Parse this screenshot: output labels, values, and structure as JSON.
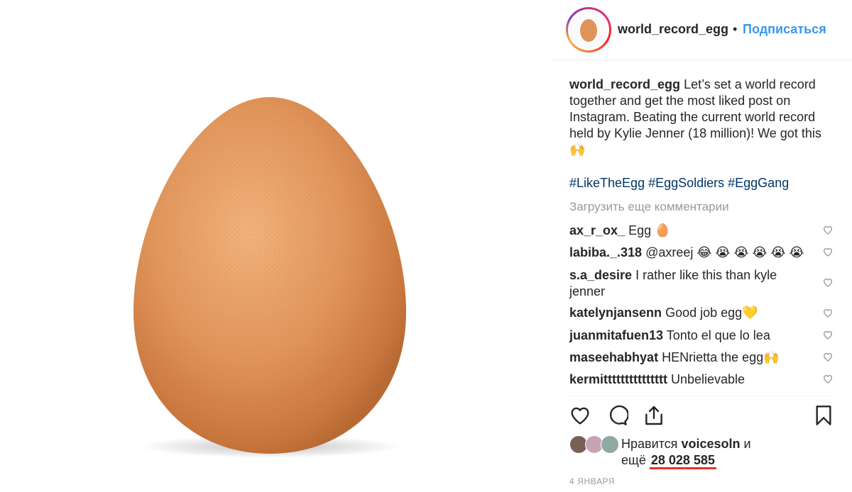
{
  "post": {
    "username": "world_record_egg",
    "separator": "•",
    "follow_label": "Подписаться",
    "caption_text": "Let’s set a world record together and get the most liked post on Instagram. Beating the current world record held by Kylie Jenner (18 million)! We got this 🙌",
    "hashtags": "#LikeTheEgg #EggSoldiers #EggGang",
    "load_more": "Загрузить еще комментарии"
  },
  "comments": [
    {
      "user": "ax_r_ox_",
      "text": "Egg 🥚"
    },
    {
      "user": "labiba._.318",
      "text": "@axreej 😂 😭 😭 😭 😭 😭"
    },
    {
      "user": "s.a_desire",
      "text": "I rather like this than kyle jenner"
    },
    {
      "user": "katelynjansenn",
      "text": "Good job egg💛"
    },
    {
      "user": "juanmitafuen13",
      "text": "Tonto el que lo lea"
    },
    {
      "user": "maseehabhyat",
      "text": "HENrietta the egg🙌"
    },
    {
      "user": "kermittttttttttttttt",
      "text": "Unbelievable"
    }
  ],
  "likes": {
    "prefix": "Нравится",
    "user": "voicesoln",
    "joiner": "и",
    "more": "ещё",
    "count": "28 028 585"
  },
  "date": "4 ЯНВАРЯ",
  "icons": {
    "like": "heart-icon",
    "comment": "comment-bubble-icon",
    "share": "share-icon",
    "save": "bookmark-icon"
  },
  "colors": {
    "link": "#3897f0",
    "hashtag": "#003569",
    "underline": "#e8312b",
    "egg": "#e0945a"
  }
}
